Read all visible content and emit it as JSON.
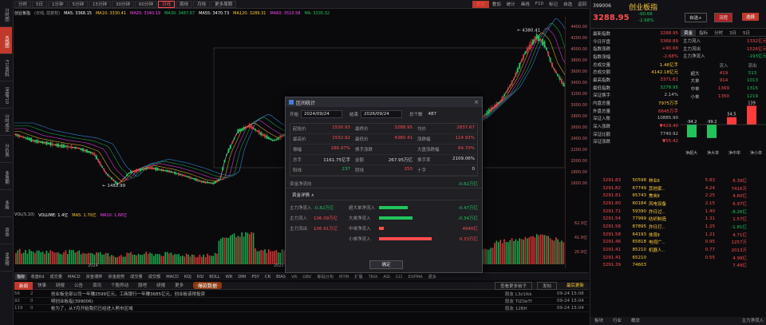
{
  "sidebar": [
    "分时图",
    "K线图",
    "F10资料",
    "深度F10",
    "分时成交",
    "分价表",
    "多周期",
    "多股",
    "资金",
    "龙虎榜"
  ],
  "periods": [
    "分时",
    "5日",
    "1分钟",
    "5分钟",
    "15分钟",
    "30分钟",
    "60分钟",
    "日线",
    "周线",
    "月线",
    "更多周期"
  ],
  "toolbar_right": [
    "复权",
    "叠加",
    "统计",
    "画线",
    "F10",
    "标记",
    "自选",
    "返回"
  ],
  "index_title": "创业板指",
  "period_note": "(日线, 前复权)",
  "ma": [
    {
      "l": "MA5: 3368.15",
      "c": "#ffffff"
    },
    {
      "l": "MA10: 3330.41",
      "c": "#ffcc33"
    },
    {
      "l": "MA20: 3340.19",
      "c": "#ff44ff"
    },
    {
      "l": "MA30: 3487.67",
      "c": "#21c45a"
    },
    {
      "l": "MA55: 3470.73",
      "c": "#ffffff"
    },
    {
      "l": "MA120: 3289.31",
      "c": "#ffcc33"
    },
    {
      "l": "MA60: 3510.58",
      "c": "#ff44ff"
    },
    {
      "l": "MA: 3335.32",
      "c": "#21c45a"
    }
  ],
  "chart_data": {
    "type": "candlestick",
    "annotations": [
      "4380.41",
      "1482.99"
    ],
    "x_labels": [
      "2024",
      "2025"
    ],
    "yaxis": [
      "4400.00",
      "4200.00",
      "4000.00",
      "3800.00",
      "3600.00",
      "3400.00",
      "3200.00",
      "3000.00",
      "2800.00",
      "2600.00",
      "2400.00",
      "2200.00",
      "2000.00",
      "1800.00",
      "1600.00"
    ],
    "volume_yaxis": [
      "62.9亿",
      "41.9亿",
      "20.9亿"
    ]
  },
  "vol_labels": [
    {
      "l": "VOL(5,10)",
      "c": "#bbbbbb"
    },
    {
      "l": "VOLUME: 1.4亿",
      "c": "#ffffff"
    },
    {
      "l": "MA5: 1.70亿",
      "c": "#ffcc33"
    },
    {
      "l": "MA10: 1.68亿",
      "c": "#ff44ff"
    }
  ],
  "indicators": [
    "指标",
    "收盘Kd",
    "成交量",
    "MACD",
    "资金博弈",
    "资金趋势",
    "成交量",
    "成交额",
    "MACD",
    "KDJ",
    "RSI",
    "BOLL",
    "WR",
    "DMI",
    "PSY",
    "CR",
    "BIAS",
    "VR",
    "OBV",
    "筹码分布",
    "MTM",
    "扩展",
    "TRIX",
    "ASI",
    "CCI",
    "EXPMA",
    "更多"
  ],
  "news_tabs": [
    "新闻",
    "快事",
    "研报",
    "公告",
    "资讯",
    "个股异动",
    "股吧",
    "研报",
    "更多"
  ],
  "news_alert": "·爆款数据·",
  "news_btns": [
    "查看更多帖子",
    "发帖",
    "最后更新"
  ],
  "news": [
    {
      "n": "56",
      "r": "2",
      "t": "创业板全部公司一年赚2599亿元，工商银行一年赚3685亿元，创业板该得投资",
      "s": "股友 L3z1lkk",
      "tm": "09-24 15:08"
    },
    {
      "n": "92",
      "r": "0",
      "t": "明创业板指(399006)",
      "s": "股友 TIZ0eTf",
      "tm": "09-24 15:04"
    },
    {
      "n": "119",
      "r": "0",
      "t": "帐为了，从7月开始我们已经进入熊市区域",
      "s": "股友 12BH",
      "tm": "09-24 15:04"
    }
  ],
  "dialog": {
    "title": "区间统计",
    "start_label": "开始",
    "start": "2024/09/24",
    "end_label": "结束",
    "end": "2026/09/24",
    "count_label": "总个数",
    "count": "487",
    "rows": [
      [
        {
          "k": "起始价",
          "v": "1530.93",
          "c": "red"
        },
        {
          "k": "最终价",
          "v": "3288.95",
          "c": "red"
        },
        {
          "k": "均价",
          "v": "2837.67",
          "c": "red"
        }
      ],
      [
        {
          "k": "最高价",
          "v": "1532.92",
          "c": "red"
        },
        {
          "k": "最低价",
          "v": "4380.41",
          "c": "red"
        },
        {
          "k": "涨跌幅",
          "v": "114.93%",
          "c": "red"
        }
      ],
      [
        {
          "k": "振幅",
          "v": "186.97%",
          "c": "red"
        },
        {
          "k": "换手涨跌",
          "v": "",
          "c": ""
        },
        {
          "k": "大盘涨跌幅",
          "v": "64.70%",
          "c": "red"
        }
      ],
      [
        {
          "k": "总手",
          "v": "1161.75亿手",
          "c": ""
        },
        {
          "k": "金额",
          "v": "267.95万亿",
          "c": ""
        },
        {
          "k": "换手率",
          "v": "2109.06%",
          "c": ""
        }
      ],
      [
        {
          "k": "阳线",
          "v": "237",
          "c": "grn"
        },
        {
          "k": "阴线",
          "v": "250",
          "c": "red"
        },
        {
          "k": "十字",
          "v": "0",
          "c": ""
        }
      ]
    ],
    "flow_label": "资金净流向",
    "flow_value": "-0.82万亿",
    "detail_title": "资金详情",
    "detail": [
      {
        "a": "主力净流入",
        "b": "-0.82万亿",
        "c": "超大单净流入",
        "d": "-0.47万亿",
        "w": 36,
        "col": "#21c45a"
      },
      {
        "a": "主力流入",
        "b": "106.09万亿",
        "c": "大单净流入",
        "d": "-0.34万亿",
        "w": 42,
        "col": "#21c45a"
      },
      {
        "a": "主力流出",
        "b": "106.91万亿",
        "c": "中单净流入",
        "d": "4940亿",
        "w": 6,
        "col": "#ff4d4d"
      },
      {
        "a": "",
        "b": "",
        "c": "小单净流入",
        "d": "0.33万亿",
        "w": 66,
        "col": "#ff4d4d"
      }
    ],
    "ok": "确定"
  },
  "quote": {
    "code": "399006",
    "name": "创业板指",
    "price": "3288.95",
    "chg": "-90.66",
    "pct": "-2.68%",
    "btns": [
      "自选+",
      "流程",
      "选择"
    ],
    "stats": [
      {
        "k": "最新指数",
        "v": "3288.95",
        "c": "red"
      },
      {
        "k": "今日开盘",
        "v": "3366.89",
        "c": "red"
      },
      {
        "k": "指数涨跌",
        "v": "+90.66",
        "c": "red"
      },
      {
        "k": "指数涨幅",
        "v": "-2.68%",
        "c": "red"
      },
      {
        "k": "总成交量",
        "v": "1.46亿手",
        "c": "yel"
      },
      {
        "k": "总成交额",
        "v": "4142.18亿元",
        "c": "yel"
      },
      {
        "k": "最高指数",
        "v": "3371.61",
        "c": "red"
      },
      {
        "k": "最低指数",
        "v": "3278.95",
        "c": "grn"
      },
      {
        "k": "深证换手",
        "v": "2.14%",
        "c": ""
      },
      {
        "k": "内盘总量",
        "v": "7975万手",
        "c": "yel"
      },
      {
        "k": "外盘总量",
        "v": "6645万手",
        "c": "red"
      },
      {
        "k": "深证入账",
        "v": "10885.90",
        "c": ""
      },
      {
        "k": "深入涨跌",
        "v": "▼429.40",
        "c": "red"
      },
      {
        "k": "深证比额",
        "v": "7740.92",
        "c": ""
      },
      {
        "k": "深证涨跌",
        "v": "▼55.42",
        "c": "red"
      }
    ],
    "flow_tabs": [
      "资金",
      "指标",
      "分时",
      "3日",
      "5日"
    ],
    "flow_sum": [
      {
        "k": "主力流入",
        "v": "1332亿元"
      },
      {
        "k": "主力流出",
        "v": "1526亿元"
      },
      {
        "k": "主力净流入",
        "v": "-193亿元"
      }
    ],
    "flow_tbl_hd": [
      "",
      "流入",
      "流出"
    ],
    "flow_tbl": [
      [
        "超大",
        "419",
        "513"
      ],
      [
        "大单",
        "914",
        "1013"
      ],
      [
        "中单",
        "1369",
        "1315"
      ],
      [
        "小单",
        "1350",
        "1219"
      ]
    ],
    "flow_bars": [
      {
        "v": "-94.2",
        "n": -94.2
      },
      {
        "v": "-99.2",
        "n": -99.2
      },
      {
        "v": "54.5",
        "n": 54.5
      },
      {
        "v": "139",
        "n": 139
      }
    ],
    "flow_bar_labels": [
      "净超大",
      "净大单",
      "净中单",
      "净小单"
    ],
    "ticks": [
      [
        "3291.83",
        "50598",
        "林业Ⅱ",
        "5.83",
        "6.39亿"
      ],
      [
        "3291.82",
        "67749",
        "其他家..",
        "4.24",
        "7416万"
      ],
      [
        "3291.81",
        "65743",
        "焦炭Ⅱ",
        "2.25",
        "4.60亿"
      ],
      [
        "3291.80",
        "60184",
        "风电设备",
        "2.15",
        "6.97亿"
      ],
      [
        "3291.71",
        "59390",
        "炸日过..",
        "1.40",
        "-8.26亿"
      ],
      [
        "3291.54",
        "77999",
        "纺织制造",
        "1.31",
        "1.57亿"
      ],
      [
        "3291.58",
        "87895",
        "炸日打..",
        "1.25",
        "-1.81亿"
      ],
      [
        "3291.58",
        "64193",
        "体育Ⅱ",
        "1.21",
        "4.71亿"
      ],
      [
        "3291.46",
        "65818",
        "电视广..",
        "0.95",
        "1257万"
      ],
      [
        "3291.41",
        "85210",
        "机器人..",
        "0.77",
        "2013万"
      ],
      [
        "3291.41",
        "65210",
        "",
        "0.55",
        "4.99亿"
      ],
      [
        "3291.39",
        "74603",
        "",
        "",
        "7.49亿"
      ]
    ],
    "plate_hd": [
      "主力净流入"
    ],
    "plate_tabs": [
      "板块",
      "行业",
      "概念"
    ]
  }
}
